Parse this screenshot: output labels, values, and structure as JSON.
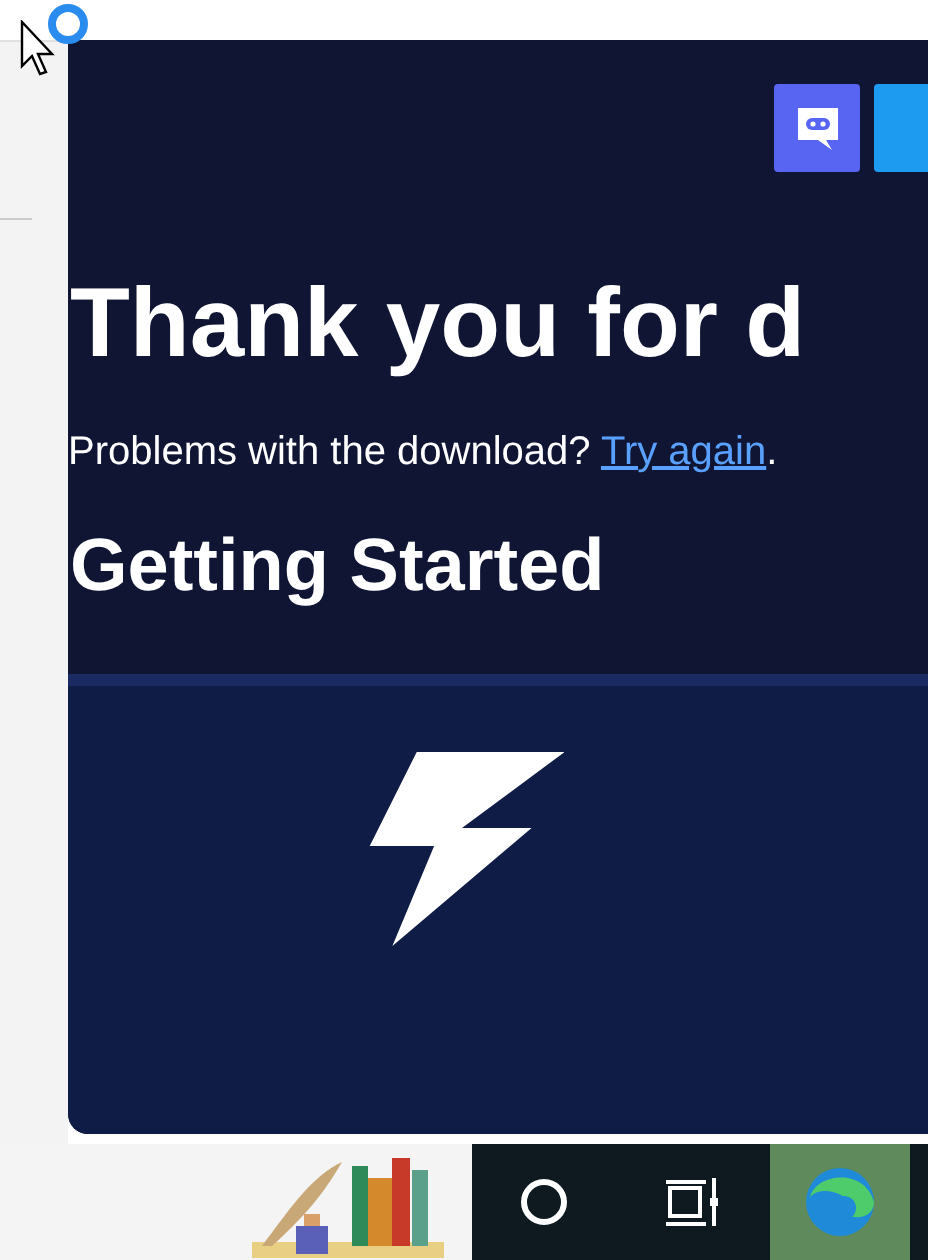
{
  "page": {
    "social_buttons": [
      {
        "kind": "discord"
      },
      {
        "kind": "partial"
      }
    ],
    "heading": "Thank you for d",
    "problem_text": "Problems with the download?",
    "retry_link": "Try again",
    "after_link": ".",
    "subheading": "Getting Started",
    "card": {
      "kind": "lightning"
    }
  },
  "taskbar": {
    "items": [
      {
        "kind": "app",
        "selected": false
      },
      {
        "kind": "search",
        "selected": false
      },
      {
        "kind": "taskview",
        "selected": false
      },
      {
        "kind": "edge",
        "selected": true
      }
    ]
  }
}
